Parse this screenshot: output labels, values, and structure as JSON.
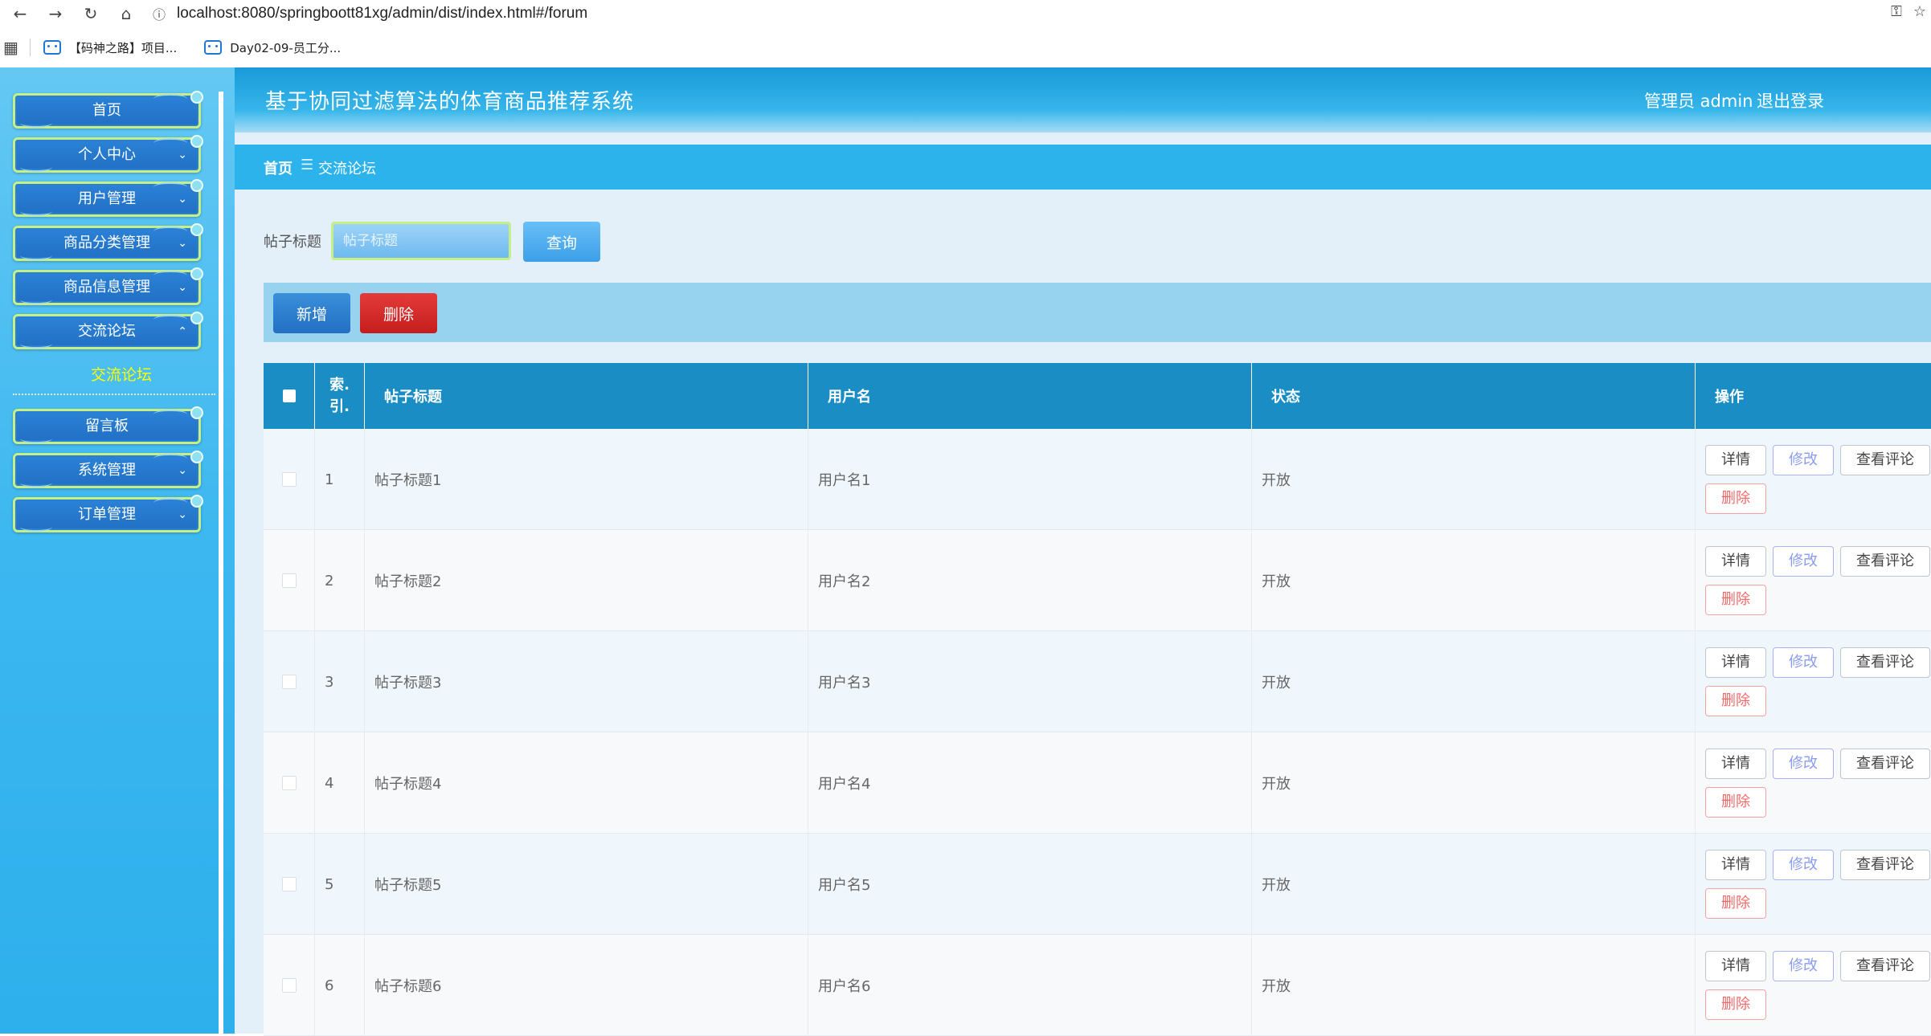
{
  "browser": {
    "back_icon": "←",
    "forward_icon": "→",
    "reload_icon": "↻",
    "home_icon": "⌂",
    "info_icon": "ⓘ",
    "url": "localhost:8080/springboott81xg/admin/dist/index.html#/forum",
    "bookmarks": [
      "【码神之路】项目...",
      "Day02-09-员工分..."
    ]
  },
  "app": {
    "title": "基于协同过滤算法的体育商品推荐系统"
  },
  "header": {
    "user_label": "管理员 admin",
    "logout_label": "退出登录"
  },
  "sidebar": {
    "items": [
      {
        "label": "首页"
      },
      {
        "label": "个人中心"
      },
      {
        "label": "用户管理"
      },
      {
        "label": "商品分类管理"
      },
      {
        "label": "商品信息管理"
      },
      {
        "label": "交流论坛"
      },
      {
        "label": "留言板"
      },
      {
        "label": "系统管理"
      },
      {
        "label": "订单管理"
      }
    ],
    "active_submenu": "交流论坛"
  },
  "breadcrumb": {
    "home": "首页",
    "current": "交流论坛"
  },
  "search": {
    "label": "帖子标题",
    "placeholder": "帖子标题",
    "button": "查询"
  },
  "actions": {
    "add": "新增",
    "delete": "删除"
  },
  "table": {
    "columns": [
      "索引",
      "帖子标题",
      "用户名",
      "状态",
      "操作"
    ],
    "index_header_line1": "索.",
    "index_header_line2": "引.",
    "rows": [
      {
        "index": "1",
        "title": "帖子标题1",
        "username": "用户名1",
        "status": "开放"
      },
      {
        "index": "2",
        "title": "帖子标题2",
        "username": "用户名2",
        "status": "开放"
      },
      {
        "index": "3",
        "title": "帖子标题3",
        "username": "用户名3",
        "status": "开放"
      },
      {
        "index": "4",
        "title": "帖子标题4",
        "username": "用户名4",
        "status": "开放"
      },
      {
        "index": "5",
        "title": "帖子标题5",
        "username": "用户名5",
        "status": "开放"
      },
      {
        "index": "6",
        "title": "帖子标题6",
        "username": "用户名6",
        "status": "开放"
      }
    ],
    "row_buttons": {
      "detail": "详情",
      "edit": "修改",
      "comments": "查看评论",
      "delete": "删除"
    }
  },
  "colors": {
    "sidebar": "#3cb7f0",
    "header": "#1a9ad8",
    "table_header": "#1b8dc5",
    "delete_red": "#d42727",
    "submenu_active": "#ffff00"
  }
}
